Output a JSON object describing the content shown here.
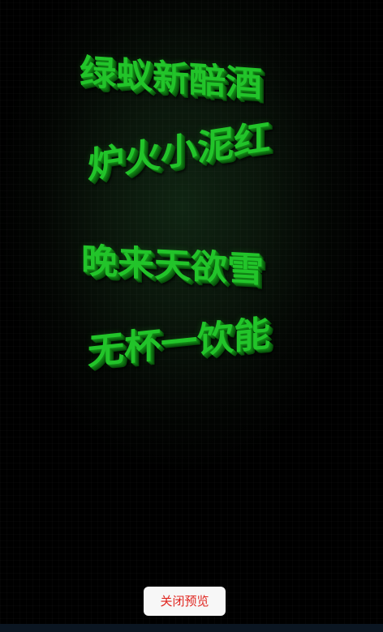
{
  "poem": {
    "lines": [
      "绿蚁新醅酒",
      "炉火小泥红",
      "晚来天欲雪",
      "无杯一饮能"
    ]
  },
  "footer": {
    "close_label": "关闭预览"
  },
  "colors": {
    "text_green": "#22c42a",
    "button_text": "#e0251f",
    "button_bg": "#f7f7f7",
    "background": "#000000"
  }
}
